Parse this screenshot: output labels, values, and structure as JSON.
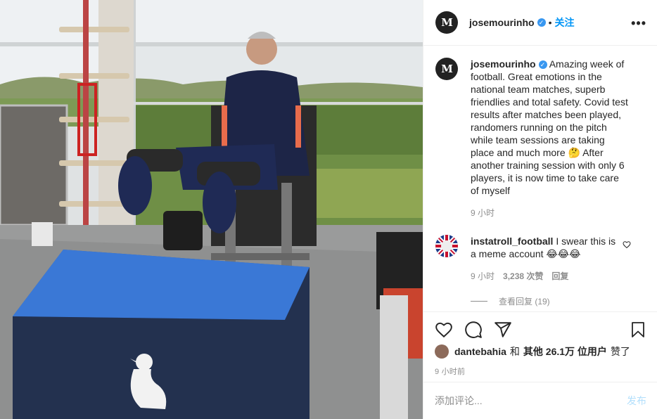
{
  "header": {
    "username": "josemourinho",
    "verified_mark": "✓",
    "separator": "•",
    "follow_label": "关注",
    "more_label": "•••",
    "avatar_text": "M"
  },
  "caption": {
    "username": "josemourinho",
    "text": "Amazing week of football. Great emotions in the national team matches, superb friendlies and total safety. Covid test results after matches been played, randomers running on the pitch while team sessions are taking place and much more 🤔 After another training session with only 6 players, it is now time to take care of myself",
    "time": "9 小时"
  },
  "comment": {
    "username": "instatroll_football",
    "text": "I swear this is a meme account 😂😂😂",
    "time": "9 小时",
    "likes": "3,238 次赞",
    "reply_label": "回复",
    "view_replies": "查看回复 (19)"
  },
  "actions": {
    "icons": [
      "heart-icon",
      "comment-icon",
      "share-icon",
      "bookmark-icon"
    ],
    "liked_by_user": "dantebahia",
    "liked_mid": "和",
    "liked_others": "其他 26.1万 位用户",
    "liked_suffix": "赞了",
    "timestamp": "9 小时前"
  },
  "add_comment": {
    "placeholder": "添加评论...",
    "post_label": "发布"
  },
  "colors": {
    "link_blue": "#0095f6",
    "verified_blue": "#3897f0",
    "muted": "#8e8e8e",
    "post_disabled": "#b2dffc"
  }
}
